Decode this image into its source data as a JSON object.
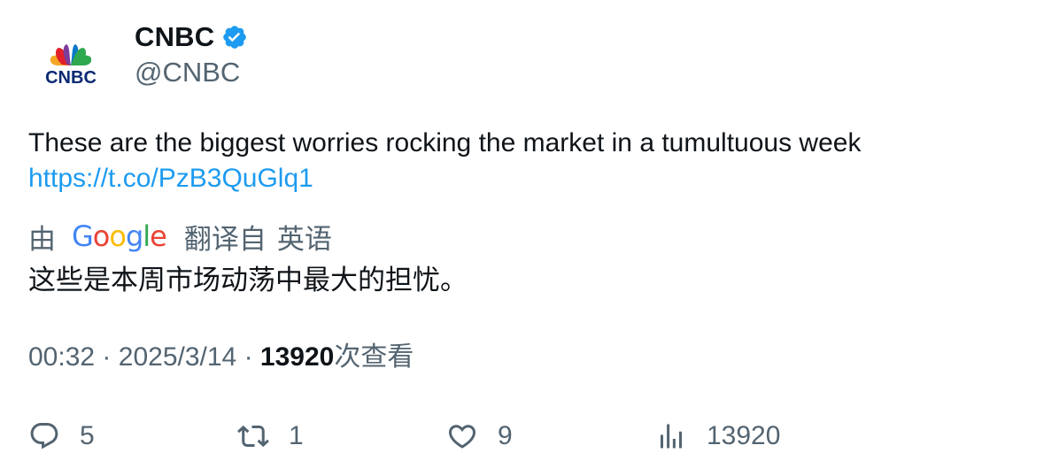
{
  "author": {
    "display_name": "CNBC",
    "handle": "@CNBC",
    "avatar_icon": "cnbc-peacock-logo",
    "logo_text": "CNBC",
    "verified_icon": "verified-badge-icon",
    "verified_color": "#1d9bf0"
  },
  "tweet": {
    "text": "These are the biggest worries rocking the market in a tumultuous week",
    "link": "https://t.co/PzB3QuGlq1"
  },
  "translation": {
    "by_label": "由",
    "provider": "Google",
    "from_label": "翻译自",
    "language": "英语",
    "translated_text": "这些是本周市场动荡中最大的担忧。"
  },
  "meta": {
    "time": "00:32",
    "separator": "·",
    "date": "2025/3/14",
    "views_count": "13920",
    "views_label": "次查看"
  },
  "actions": {
    "reply": {
      "icon": "reply-icon",
      "count": "5"
    },
    "retweet": {
      "icon": "retweet-icon",
      "count": "1"
    },
    "like": {
      "icon": "heart-icon",
      "count": "9"
    },
    "views": {
      "icon": "analytics-icon",
      "count": "13920"
    }
  },
  "colors": {
    "text_primary": "#0f1419",
    "text_secondary": "#536471",
    "link": "#1d9bf0"
  }
}
